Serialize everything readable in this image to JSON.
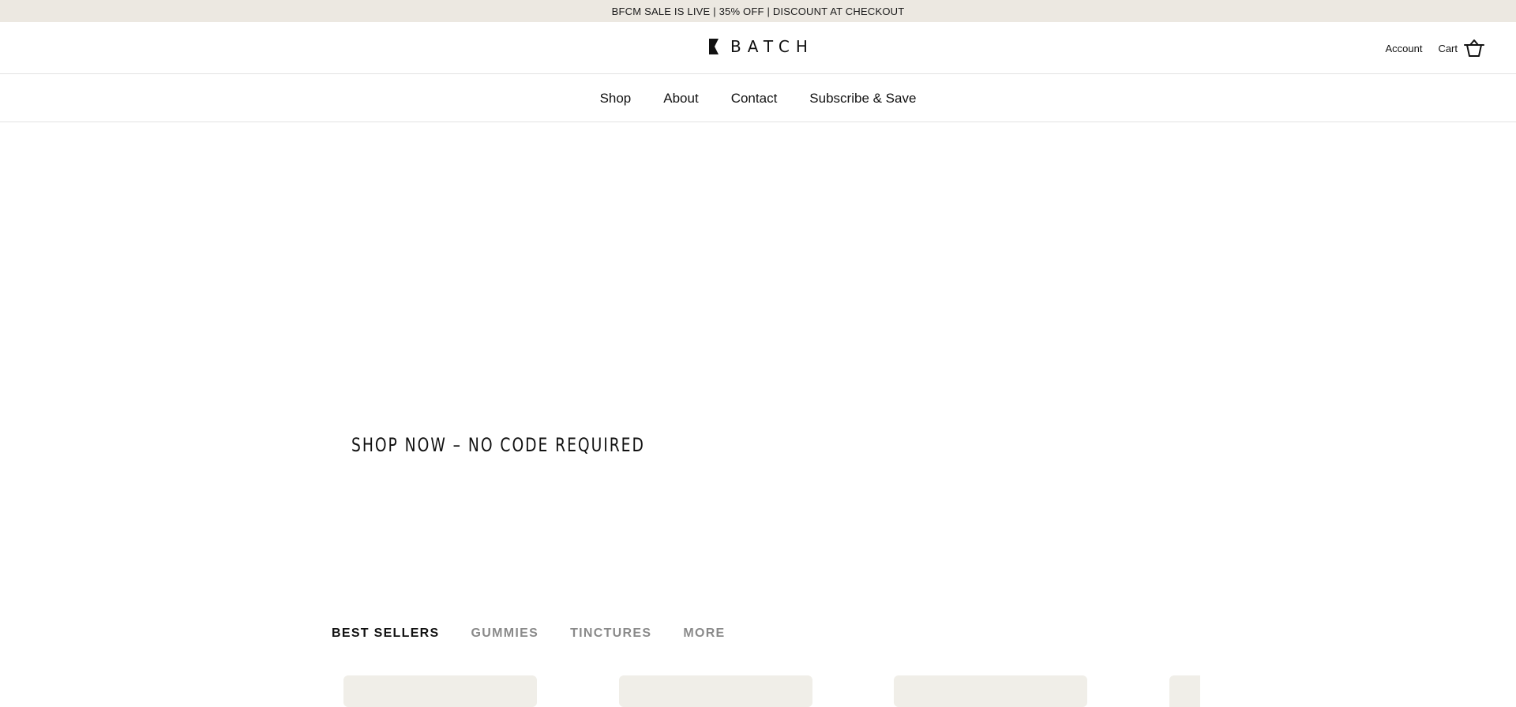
{
  "announcement": {
    "text": "BFCM SALE IS LIVE | 35% OFF | DISCOUNT AT CHECKOUT"
  },
  "header": {
    "logo_text": "BATCH",
    "account_label": "Account",
    "cart_label": "Cart",
    "cart_icon": "basket-icon"
  },
  "nav": {
    "items": [
      {
        "label": "Shop"
      },
      {
        "label": "About"
      },
      {
        "label": "Contact"
      },
      {
        "label": "Subscribe & Save"
      }
    ]
  },
  "hero": {
    "cta_text": "SHOP NOW – NO CODE REQUIRED"
  },
  "tabs": {
    "items": [
      {
        "label": "BEST SELLERS",
        "active": true
      },
      {
        "label": "GUMMIES",
        "active": false
      },
      {
        "label": "TINCTURES",
        "active": false
      },
      {
        "label": "MORE",
        "active": false
      }
    ]
  },
  "colors": {
    "announcement_bg": "#ece8e1",
    "card_bg": "#f0eee8",
    "text": "#111111",
    "inactive_tab": "#8a8a8a"
  }
}
